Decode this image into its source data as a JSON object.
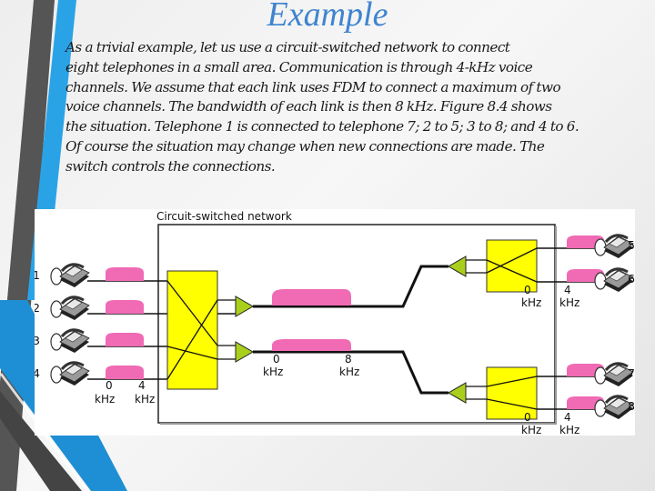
{
  "slide": {
    "title": "Example",
    "paragraph_lines": [
      "As a trivial example, let us use a circuit-switched network to connect",
      "eight telephones in a small area. Communication is through 4-kHz voice",
      "channels. We assume that each link uses FDM to connect a maximum of two",
      "voice channels. The bandwidth of each link is then 8 kHz. Figure 8.4 shows",
      "the situation. Telephone 1 is connected to telephone 7; 2 to 5; 3 to 8; and 4 to 6.",
      "Of course the situation may change when new connections are made. The",
      "switch controls the connections."
    ],
    "colors": {
      "title": "#3f84cf",
      "accent_blue": "#29a3e6",
      "accent_dark": "#555555",
      "switch_fill": "#ffff00",
      "signal_fill": "#f06ab4",
      "mux_fill": "#a9cf1c"
    }
  },
  "figure": {
    "title": "Circuit-switched network",
    "left_phones": [
      "1",
      "2",
      "3",
      "4"
    ],
    "right_phones": [
      "5",
      "6",
      "7",
      "8"
    ],
    "voice_band": {
      "low": "0",
      "high": "4",
      "unit": "kHz"
    },
    "link_band": {
      "low": "0",
      "high": "8",
      "unit": "kHz"
    },
    "connections": [
      {
        "from": "1",
        "to": "7"
      },
      {
        "from": "2",
        "to": "5"
      },
      {
        "from": "3",
        "to": "8"
      },
      {
        "from": "4",
        "to": "6"
      }
    ],
    "icons": {
      "phone": "telephone-icon",
      "switch": "crossbar-switch",
      "mux": "multiplexer-triangle",
      "spectrum": "spectrum-bump"
    }
  }
}
